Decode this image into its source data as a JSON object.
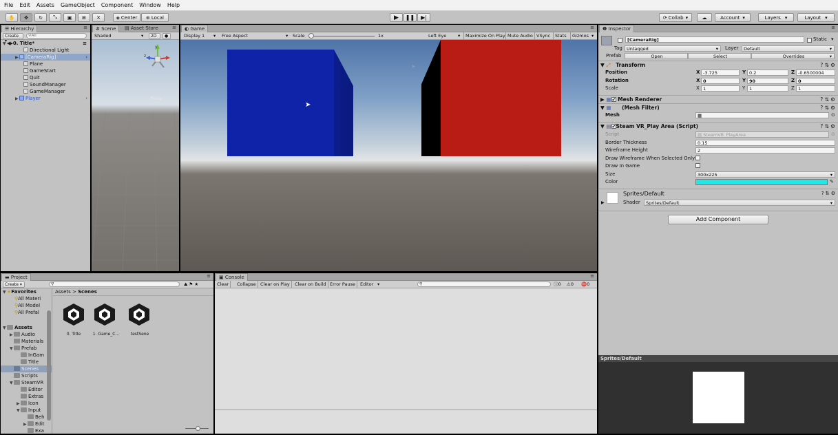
{
  "menu": [
    "File",
    "Edit",
    "Assets",
    "GameObject",
    "Component",
    "Window",
    "Help"
  ],
  "toolbar": {
    "center_label": "Center",
    "local_label": "Local",
    "collab_label": "Collab",
    "account_label": "Account",
    "layers_label": "Layers",
    "layout_label": "Layout"
  },
  "hierarchy": {
    "tab": "Hierarchy",
    "create_label": "Create",
    "search_placeholder": "All",
    "scene_name": "0. Title*",
    "items": [
      {
        "label": "Directional Light"
      },
      {
        "label": "[CameraRig]"
      },
      {
        "label": "Plane"
      },
      {
        "label": "GameStart"
      },
      {
        "label": "Quit"
      },
      {
        "label": "SoundManager"
      },
      {
        "label": "GameManager"
      },
      {
        "label": "Player"
      }
    ]
  },
  "scene": {
    "tab": "Scene",
    "store_tab": "Asset Store",
    "shaded_label": "Shaded",
    "mode_2d": "2D",
    "persp_label": "Persp"
  },
  "game": {
    "tab": "Game",
    "display_label": "Display 1",
    "aspect_label": "Free Aspect",
    "scale_label": "Scale",
    "scale_value": "1x",
    "left_eye_label": "Left Eye",
    "maximize_label": "Maximize On Play",
    "mute_label": "Mute Audio",
    "vsync_label": "VSync",
    "stats_label": "Stats",
    "gizmos_label": "Gizmos"
  },
  "inspector": {
    "tab": "Inspector",
    "object_name": "[CameraRig]",
    "static_label": "Static",
    "tag_label": "Tag",
    "tag_value": "Untagged",
    "layer_label": "Layer",
    "layer_value": "Default",
    "prefab_label": "Prefab",
    "prefab_open": "Open",
    "prefab_select": "Select",
    "prefab_overrides": "Overrides",
    "transform": {
      "title": "Transform",
      "position_label": "Position",
      "rotation_label": "Rotation",
      "scale_label": "Scale",
      "position": {
        "x": "-3.725",
        "y": "0.2",
        "z": "-0.6500004"
      },
      "rotation": {
        "x": "0",
        "y": "90",
        "z": "0"
      },
      "scale": {
        "x": "1",
        "y": "1",
        "z": "1"
      }
    },
    "mesh_renderer_title": "Mesh Renderer",
    "mesh_filter_title": "(Mesh Filter)",
    "mesh_label": "Mesh",
    "play_area": {
      "title": "Steam VR_Play Area (Script)",
      "script_label": "Script",
      "script_value": "SteamVR_PlayArea",
      "border_label": "Border Thickness",
      "border_value": "0.15",
      "wire_label": "Wireframe Height",
      "wire_value": "2",
      "draw_wire_label": "Draw Wireframe When Selected Only",
      "draw_game_label": "Draw In Game",
      "size_label": "Size",
      "size_value": "300x225",
      "color_label": "Color",
      "color_value": "#1ee8e8"
    },
    "material_name": "Sprites/Default",
    "shader_label": "Shader",
    "shader_value": "Sprites/Default",
    "add_component": "Add Component",
    "preview_title": "Sprites/Default"
  },
  "project": {
    "tab": "Project",
    "create_label": "Create",
    "favorites_label": "Favorites",
    "favorites": [
      "All Materi",
      "All Model",
      "All Prefal"
    ],
    "assets_label": "Assets",
    "tree": [
      "Audio",
      "Materials",
      "Prefab",
      "InGam",
      "Title",
      "Scenes",
      "Scripts",
      "SteamVR",
      "Editor",
      "Extras",
      "Icon",
      "Input",
      "Beh",
      "Edit",
      "Exa"
    ],
    "breadcrumb_root": "Assets",
    "breadcrumb_leaf": "Scenes",
    "files": [
      "0. Title",
      "1. Game_C...",
      "testSene"
    ]
  },
  "console": {
    "tab": "Console",
    "buttons": [
      "Clear",
      "Collapse",
      "Clear on Play",
      "Clear on Build",
      "Error Pause",
      "Editor"
    ],
    "info_count": "0",
    "warn_count": "0",
    "error_count": "0"
  },
  "colors": {
    "blue_cube": "#0f23a8",
    "red_cube": "#b81c14",
    "accent_selection": "#3d7ae8"
  }
}
